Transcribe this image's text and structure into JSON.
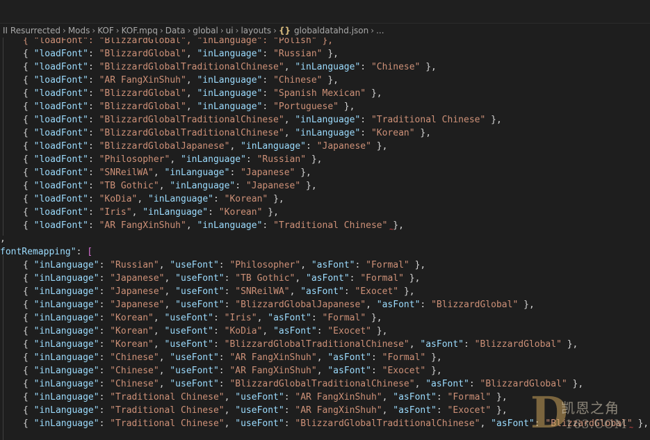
{
  "breadcrumb": {
    "items": [
      "II Resurrected",
      "Mods",
      "KOF",
      "KOF.mpq",
      "Data",
      "global",
      "ui",
      "layouts"
    ],
    "file": "globaldatahd.json",
    "file_icon": "json-braces-icon",
    "trailing": "..."
  },
  "colors": {
    "background": "#1e1e1e",
    "key": "#9cdcfe",
    "string": "#ce9178",
    "punctuation": "#d4d4d4",
    "bracket": "#da70d6",
    "error": "#f14c4c"
  },
  "code": {
    "partial_top_line": "{ \"loadFont\": \"BlizzardGlobal\", \"inLanguage\": \"Polish\" },",
    "loadFonts": [
      {
        "font": "BlizzardGlobal",
        "lang": "Russian"
      },
      {
        "font": "BlizzardGlobalTraditionalChinese",
        "lang": "Chinese"
      },
      {
        "font": "AR FangXinShuh",
        "lang": "Chinese"
      },
      {
        "font": "BlizzardGlobal",
        "lang": "Spanish Mexican"
      },
      {
        "font": "BlizzardGlobal",
        "lang": "Portuguese"
      },
      {
        "font": "BlizzardGlobalTraditionalChinese",
        "lang": "Traditional Chinese"
      },
      {
        "font": "BlizzardGlobalTraditionalChinese",
        "lang": "Korean"
      },
      {
        "font": "BlizzardGlobalJapanese",
        "lang": "Japanese"
      },
      {
        "font": "Philosopher",
        "lang": "Russian"
      },
      {
        "font": "SNReilWA",
        "lang": "Japanese"
      },
      {
        "font": "TB Gothic",
        "lang": "Japanese"
      },
      {
        "font": "KoDia",
        "lang": "Korean"
      },
      {
        "font": "Iris",
        "lang": "Korean"
      },
      {
        "font": "AR FangXinShuh",
        "lang": "Traditional Chinese"
      }
    ],
    "close_line": ",",
    "remap_key": "fontRemapping",
    "remaps": [
      {
        "lang": "Russian",
        "use": "Philosopher",
        "as": "Formal"
      },
      {
        "lang": "Japanese",
        "use": "TB Gothic",
        "as": "Formal"
      },
      {
        "lang": "Japanese",
        "use": "SNReilWA",
        "as": "Exocet"
      },
      {
        "lang": "Japanese",
        "use": "BlizzardGlobalJapanese",
        "as": "BlizzardGlobal"
      },
      {
        "lang": "Korean",
        "use": "Iris",
        "as": "Formal"
      },
      {
        "lang": "Korean",
        "use": "KoDia",
        "as": "Exocet"
      },
      {
        "lang": "Korean",
        "use": "BlizzardGlobalTraditionalChinese",
        "as": "BlizzardGlobal"
      },
      {
        "lang": "Chinese",
        "use": "AR FangXinShuh",
        "as": "Formal"
      },
      {
        "lang": "Chinese",
        "use": "AR FangXinShuh",
        "as": "Exocet"
      },
      {
        "lang": "Chinese",
        "use": "BlizzardGlobalTraditionalChinese",
        "as": "BlizzardGlobal"
      },
      {
        "lang": "Traditional Chinese",
        "use": "AR FangXinShuh",
        "as": "Formal"
      },
      {
        "lang": "Traditional Chinese",
        "use": "AR FangXinShuh",
        "as": "Exocet"
      },
      {
        "lang": "Traditional Chinese",
        "use": "BlizzardGlobalTraditionalChinese",
        "as": "BlizzardGlobal"
      }
    ]
  },
  "watermark": {
    "letter": "D",
    "name": "凯恩之角",
    "site": "163.COM"
  }
}
